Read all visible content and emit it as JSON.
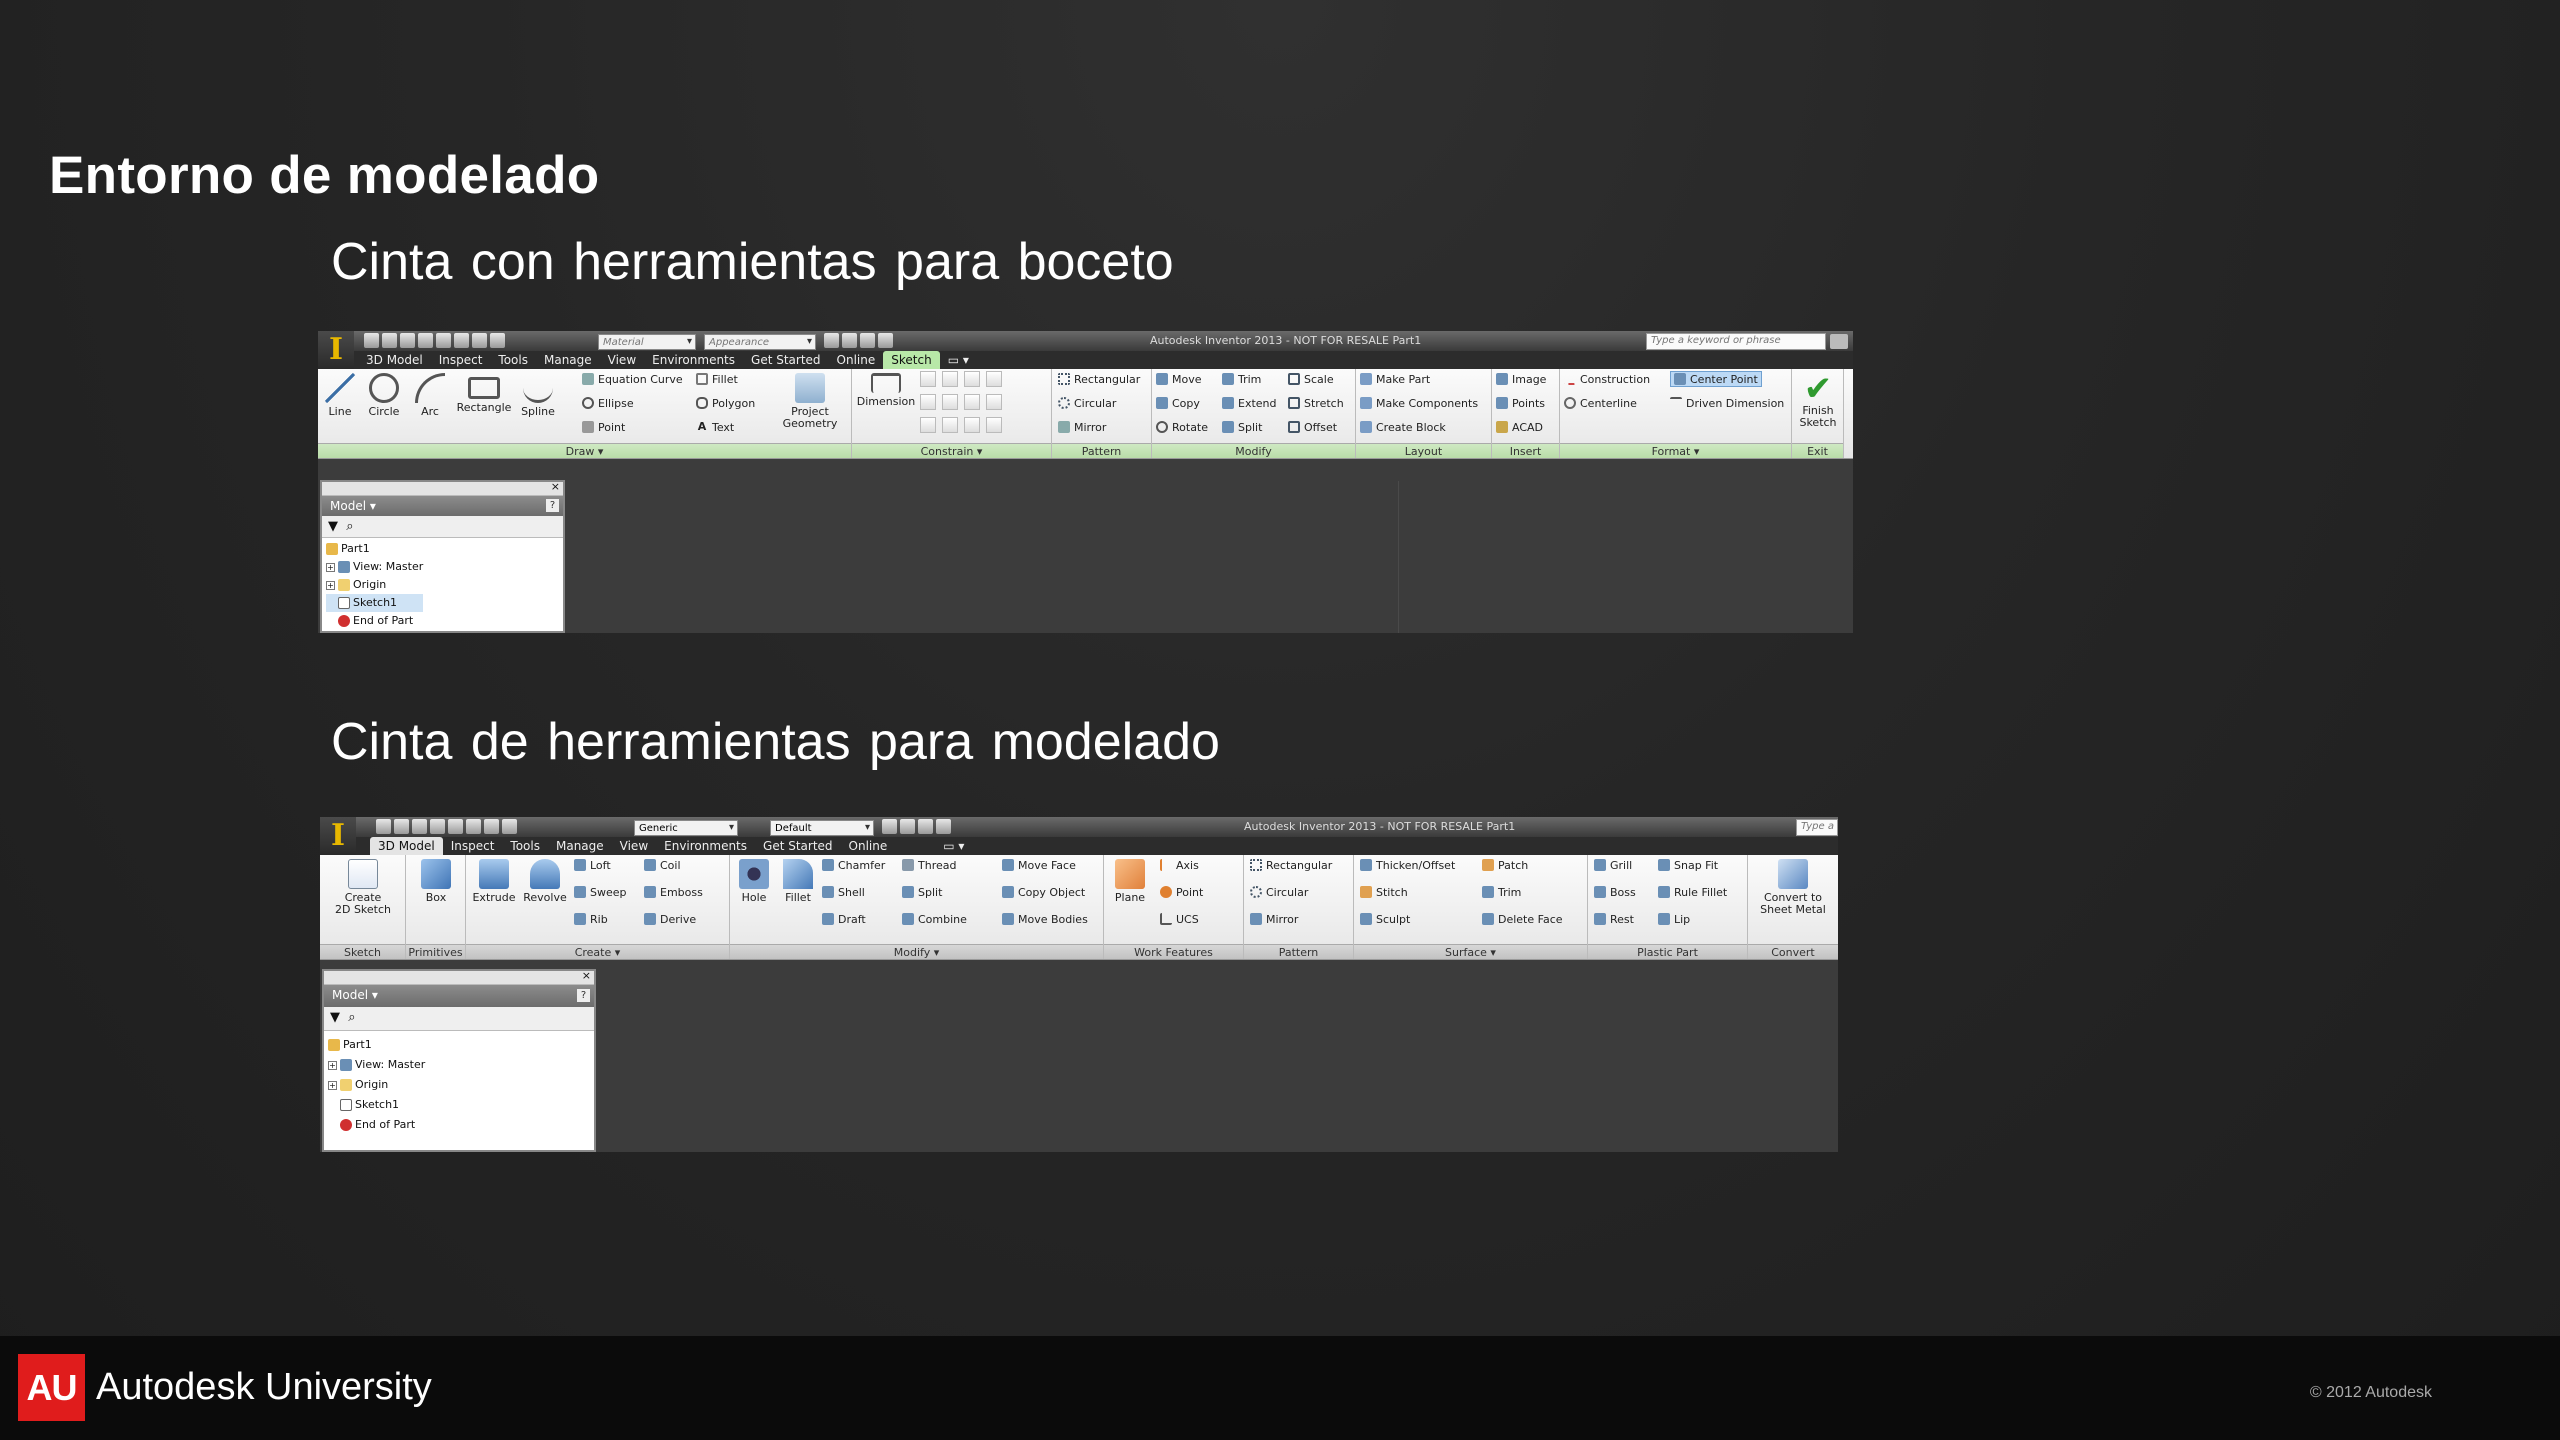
{
  "slide": {
    "title": "Entorno de modelado",
    "subtitle_sketch": "Cinta con herramientas para boceto",
    "subtitle_model": "Cinta de herramientas para modelado"
  },
  "sketch_ui": {
    "material_placeholder": "Material",
    "appearance_placeholder": "Appearance",
    "window_title": "Autodesk Inventor 2013 - NOT FOR RESALE    Part1",
    "search_placeholder": "Type a keyword or phrase",
    "tabs": [
      "3D Model",
      "Inspect",
      "Tools",
      "Manage",
      "View",
      "Environments",
      "Get Started",
      "Online",
      "Sketch"
    ],
    "draw": {
      "line": "Line",
      "circle": "Circle",
      "arc": "Arc",
      "rectangle": "Rectangle",
      "spline": "Spline",
      "equation_curve": "Equation Curve",
      "ellipse": "Ellipse",
      "point": "Point",
      "fillet": "Fillet",
      "polygon": "Polygon",
      "text": "Text",
      "project_geometry_1": "Project",
      "project_geometry_2": "Geometry",
      "label": "Draw"
    },
    "constrain": {
      "dimension": "Dimension",
      "label": "Constrain"
    },
    "pattern": {
      "rectangular": "Rectangular",
      "circular": "Circular",
      "mirror": "Mirror",
      "label": "Pattern"
    },
    "modify": {
      "move": "Move",
      "copy": "Copy",
      "rotate": "Rotate",
      "trim": "Trim",
      "extend": "Extend",
      "split": "Split",
      "scale": "Scale",
      "stretch": "Stretch",
      "offset": "Offset",
      "label": "Modify"
    },
    "layout": {
      "make_part": "Make Part",
      "make_components": "Make Components",
      "create_block": "Create Block",
      "label": "Layout"
    },
    "insert": {
      "image": "Image",
      "points": "Points",
      "acad": "ACAD",
      "label": "Insert"
    },
    "format": {
      "construction": "Construction",
      "centerline": "Centerline",
      "center_point": "Center Point",
      "driven_dimension": "Driven Dimension",
      "label": "Format"
    },
    "exit": {
      "finish_1": "Finish",
      "finish_2": "Sketch",
      "label": "Exit"
    },
    "browser": {
      "title": "Model",
      "tree": [
        "Part1",
        "View: Master",
        "Origin",
        "Sketch1",
        "End of Part"
      ]
    }
  },
  "model_ui": {
    "material_value": "Generic",
    "appearance_value": "Default",
    "window_title": "Autodesk Inventor 2013 - NOT FOR RESALE    Part1",
    "search_placeholder": "Type a",
    "tabs": [
      "3D Model",
      "Inspect",
      "Tools",
      "Manage",
      "View",
      "Environments",
      "Get Started",
      "Online"
    ],
    "sketch": {
      "create_1": "Create",
      "create_2": "2D Sketch",
      "label": "Sketch"
    },
    "primitives": {
      "box": "Box",
      "label": "Primitives"
    },
    "create": {
      "extrude": "Extrude",
      "revolve": "Revolve",
      "loft": "Loft",
      "sweep": "Sweep",
      "rib": "Rib",
      "coil": "Coil",
      "emboss": "Emboss",
      "derive": "Derive",
      "label": "Create"
    },
    "modify": {
      "hole": "Hole",
      "fillet": "Fillet",
      "chamfer": "Chamfer",
      "shell": "Shell",
      "draft": "Draft",
      "thread": "Thread",
      "split": "Split",
      "combine": "Combine",
      "move_face": "Move Face",
      "copy_object": "Copy Object",
      "move_bodies": "Move Bodies",
      "label": "Modify"
    },
    "work_features": {
      "plane": "Plane",
      "axis": "Axis",
      "point": "Point",
      "ucs": "UCS",
      "label": "Work Features"
    },
    "pattern": {
      "rectangular": "Rectangular",
      "circular": "Circular",
      "mirror": "Mirror",
      "label": "Pattern"
    },
    "surface": {
      "thicken": "Thicken/Offset",
      "stitch": "Stitch",
      "sculpt": "Sculpt",
      "patch": "Patch",
      "trim": "Trim",
      "delete_face": "Delete Face",
      "label": "Surface"
    },
    "plastic_part": {
      "grill": "Grill",
      "boss": "Boss",
      "rest": "Rest",
      "snap_fit": "Snap Fit",
      "rule_fillet": "Rule Fillet",
      "lip": "Lip",
      "label": "Plastic Part"
    },
    "convert": {
      "convert_1": "Convert to",
      "convert_2": "Sheet Metal",
      "label": "Convert"
    },
    "browser": {
      "title": "Model",
      "tree": [
        "Part1",
        "View: Master",
        "Origin",
        "Sketch1",
        "End of Part"
      ]
    }
  },
  "footer": {
    "logo_text": "AU",
    "brand": "Autodesk University",
    "copyright": "© 2012 Autodesk"
  }
}
